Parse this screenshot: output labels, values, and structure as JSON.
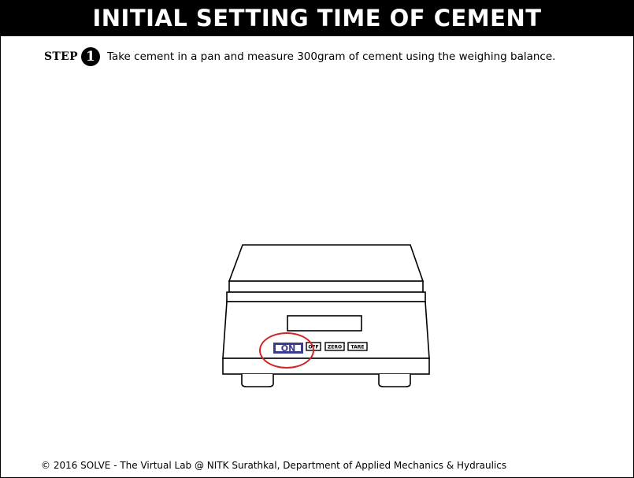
{
  "header": {
    "title": "INITIAL SETTING TIME OF CEMENT"
  },
  "step": {
    "label": "STEP",
    "number": "1",
    "instruction": "Take cement in a pan and measure 300gram of cement using the weighing balance."
  },
  "balance": {
    "buttons": {
      "on": "ON",
      "off": "OFF",
      "zero": "ZERO",
      "tare": "TARE"
    },
    "highlight_color": "#d12424",
    "on_button_color": "#3b3b8f"
  },
  "footer": {
    "copyright": "© 2016 SOLVE - The Virtual Lab @ NITK Surathkal, Department of Applied Mechanics & Hydraulics"
  }
}
